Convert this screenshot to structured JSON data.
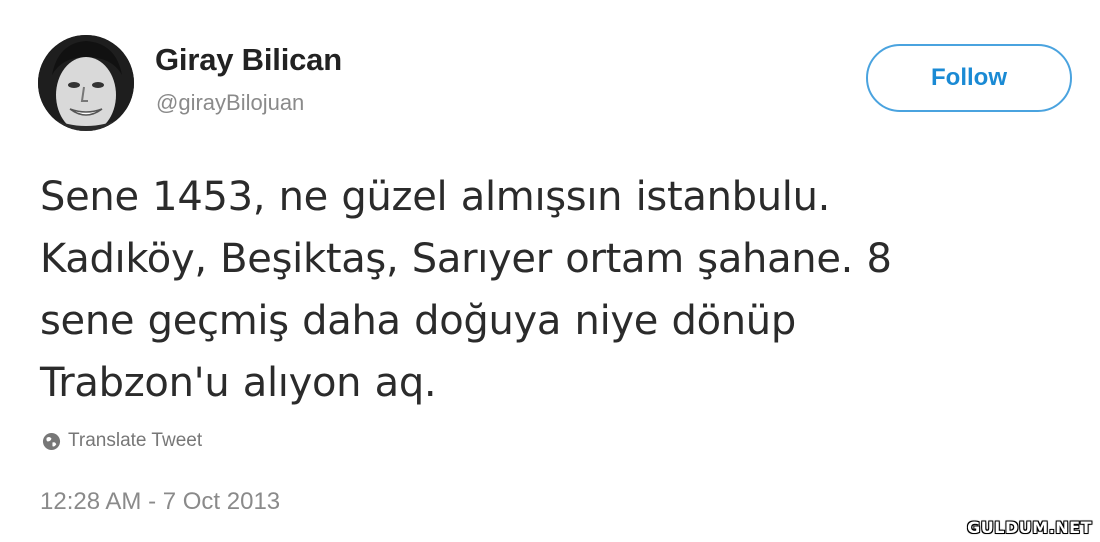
{
  "author": {
    "name": "Giray Bilican",
    "handle": "@girayBilojuan"
  },
  "follow_button": {
    "label": "Follow"
  },
  "tweet": {
    "lines": [
      "Sene 1453, ne güzel almışsın istanbulu.",
      "Kadıköy, Beşiktaş, Sarıyer ortam şahane. 8",
      "sene geçmiş daha doğuya niye dönüp",
      "Trabzon'u alıyon aq."
    ],
    "translate_label": "Translate Tweet",
    "timestamp": "12:28 AM - 7 Oct 2013"
  },
  "watermark": "GULDUM.NET",
  "icons": {
    "translate": "globe-icon",
    "avatar": "profile-photo"
  },
  "colors": {
    "follow_border": "#4aa3df",
    "follow_text": "#1a8ad4",
    "muted": "#8a8a8a"
  }
}
